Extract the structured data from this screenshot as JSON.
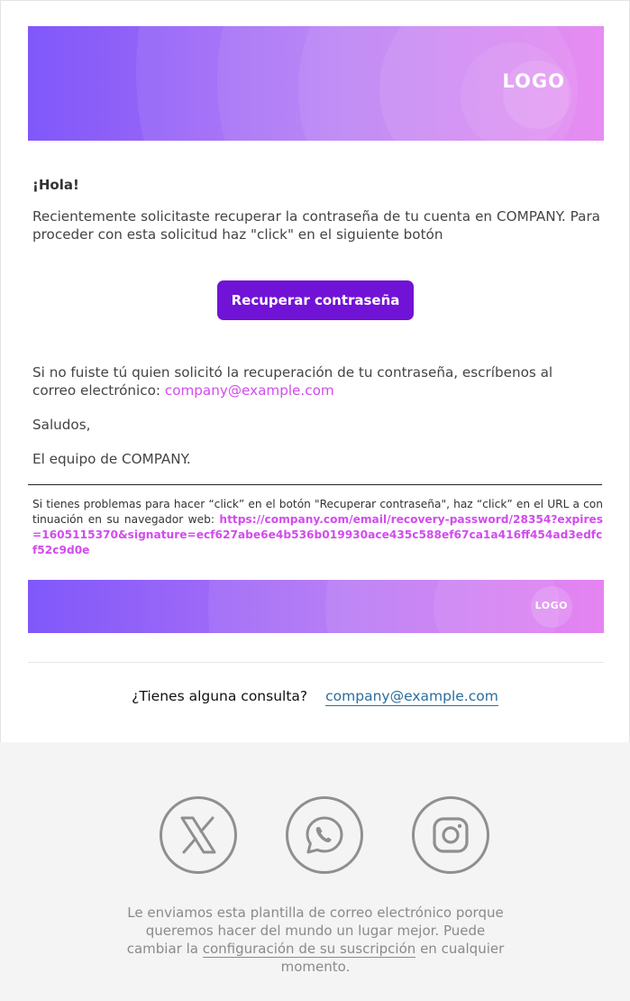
{
  "header": {
    "logo_text": "LOGO"
  },
  "body": {
    "greeting": "¡Hola!",
    "intro": "Recientemente solicitaste recuperar la contraseña de tu cuenta en COMPANY. Para proceder con esta solicitud haz \"click\" en el siguiente botón",
    "button_label": "Recuperar contraseña",
    "not_you_text": "Si no fuiste tú quien solicitó la recuperación de tu contraseña, escríbenos al correo electrónico: ",
    "not_you_email": "company@example.com",
    "regards": "Saludos,",
    "signature": "El equipo de COMPANY."
  },
  "fallback": {
    "text": "Si tienes problemas para hacer “click” en el botón \"Recuperar contraseña\", haz “click” en el URL a continuación en su navegador web: ",
    "url": "https://company.com/email/recovery-password/28354?expires=1605115370&signature=ecf627abe6e4b536b019930ace435c588ef67ca1a416ff454ad3edfcf52c9d0e"
  },
  "footer_banner": {
    "logo_text": "LOGO"
  },
  "contact": {
    "question": "¿Tienes alguna consulta?",
    "email": "company@example.com"
  },
  "social": {
    "icons": [
      "x-icon",
      "whatsapp-icon",
      "instagram-icon"
    ]
  },
  "legal": {
    "text_before": "Le enviamos esta plantilla de correo electrónico porque queremos hacer del mundo un lugar mejor. Puede cambiar la ",
    "link_label": "configuración de su suscripción",
    "text_after": " en cualquier momento."
  },
  "colors": {
    "accent_button": "#7113d6",
    "link_pink": "#d24bee",
    "link_blue": "#2b6d9f",
    "banner_start": "#8058fa",
    "banner_end": "#e271f2"
  }
}
